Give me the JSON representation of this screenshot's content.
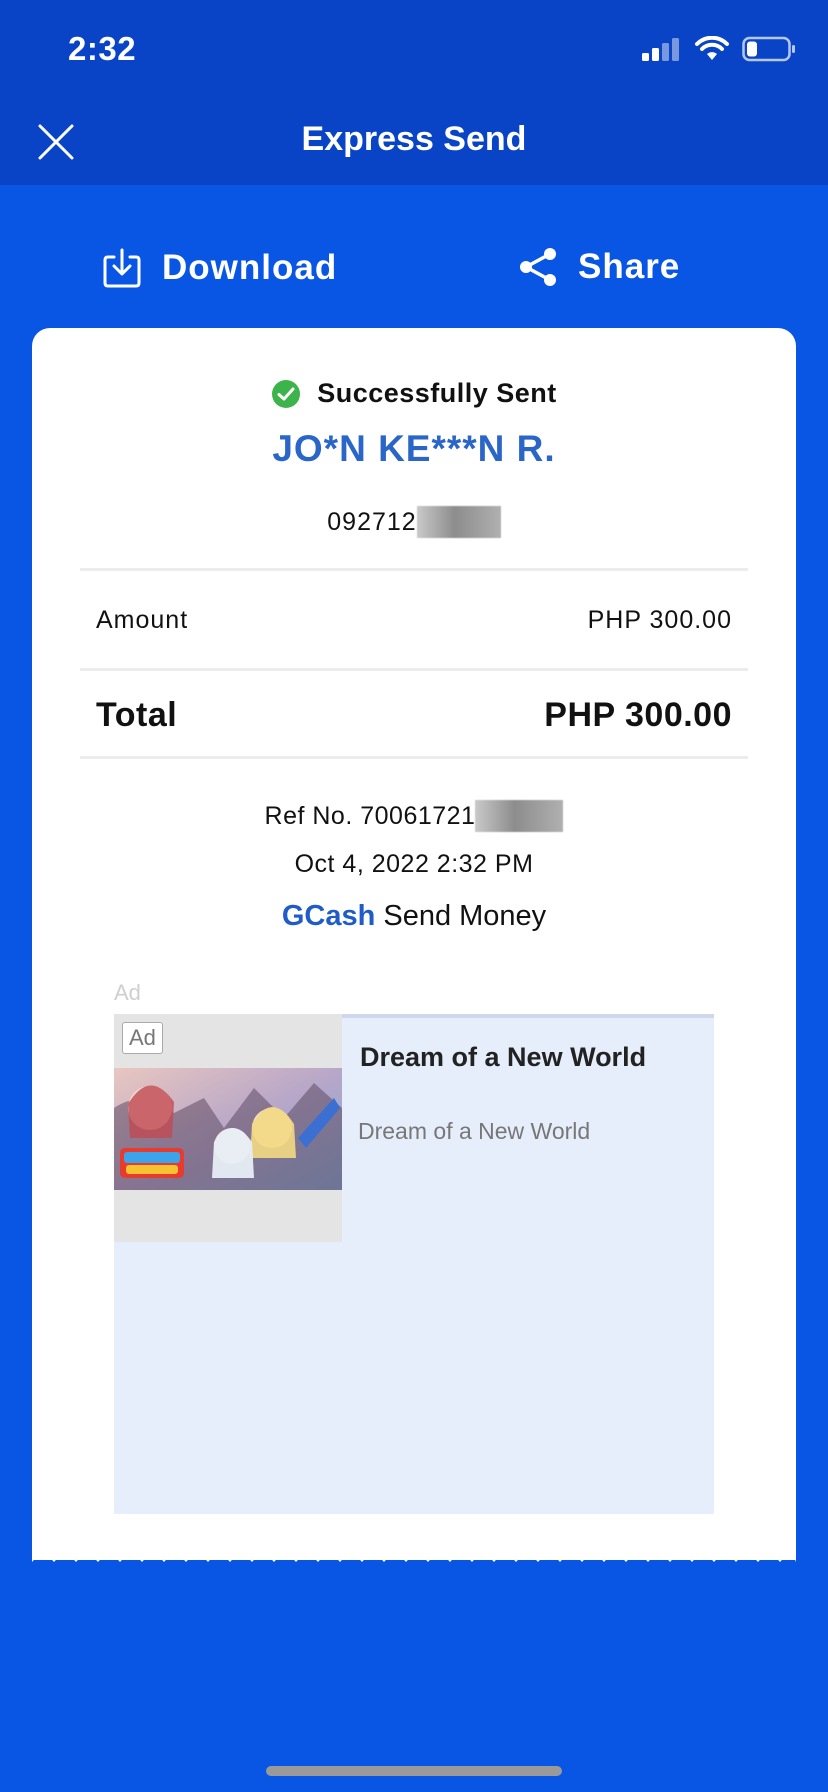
{
  "status_bar": {
    "time": "2:32",
    "icons": [
      "cellular-signal-icon",
      "wifi-icon",
      "battery-icon"
    ]
  },
  "nav": {
    "title": "Express Send",
    "close_icon": "close-icon"
  },
  "actions": {
    "download_label": "Download",
    "download_icon": "download-icon",
    "share_label": "Share",
    "share_icon": "share-icon"
  },
  "receipt": {
    "status_text": "Successfully Sent",
    "status_icon": "check-circle-icon",
    "recipient_name": "JO*N KE***N R.",
    "recipient_number_visible": "092712",
    "amount_label": "Amount",
    "amount_value": "PHP 300.00",
    "total_label": "Total",
    "total_value": "PHP 300.00",
    "ref_prefix": "Ref No. 70061721",
    "datetime": "Oct 4, 2022 2:32 PM",
    "service_brand": "GCash",
    "service_name": "Send Money"
  },
  "ad": {
    "caption": "Ad",
    "badge": "Ad",
    "title": "Dream of a New World",
    "description": "Dream of a New World"
  },
  "colors": {
    "header_bg": "#0a44c6",
    "page_bg": "#0a56e4",
    "accent_blue": "#2a66c8",
    "success_green": "#3cb44b",
    "ad_bg": "#e6eefc"
  }
}
